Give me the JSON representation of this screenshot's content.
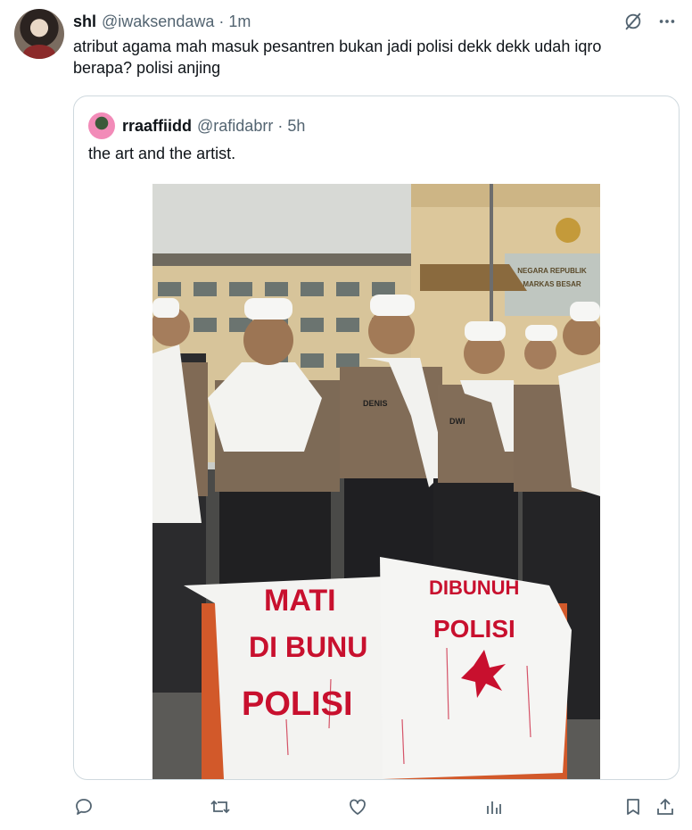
{
  "tweet": {
    "display_name": "shl",
    "handle": "@iwaksendawa",
    "separator": "·",
    "time": "1m",
    "text": "atribut agama mah masuk pesantren bukan jadi polisi dekk dekk udah iqro\nberapa? polisi anjing"
  },
  "quoted": {
    "display_name": "rraaffiidd",
    "handle": "@rafidabrr",
    "separator": "·",
    "time": "5h",
    "text": "the art and the artist."
  },
  "photo": {
    "building_sign_line1": "MARKAS BESAR",
    "building_sign_top": "NEGARA REPUBLIK",
    "banner_left": [
      "MATI",
      "DI BUNU",
      "POLISI"
    ],
    "banner_right": [
      "DIBUNUH",
      "POLISI"
    ],
    "name_tags": [
      "DENIS",
      "DWI"
    ]
  },
  "actions": {
    "icons": [
      "reply-icon",
      "repost-icon",
      "like-icon",
      "views-icon",
      "bookmark-icon",
      "share-icon"
    ]
  },
  "colors": {
    "text_primary": "#0f1419",
    "text_secondary": "#536471",
    "border": "#cfd9de",
    "banner_red": "#c8102e"
  }
}
